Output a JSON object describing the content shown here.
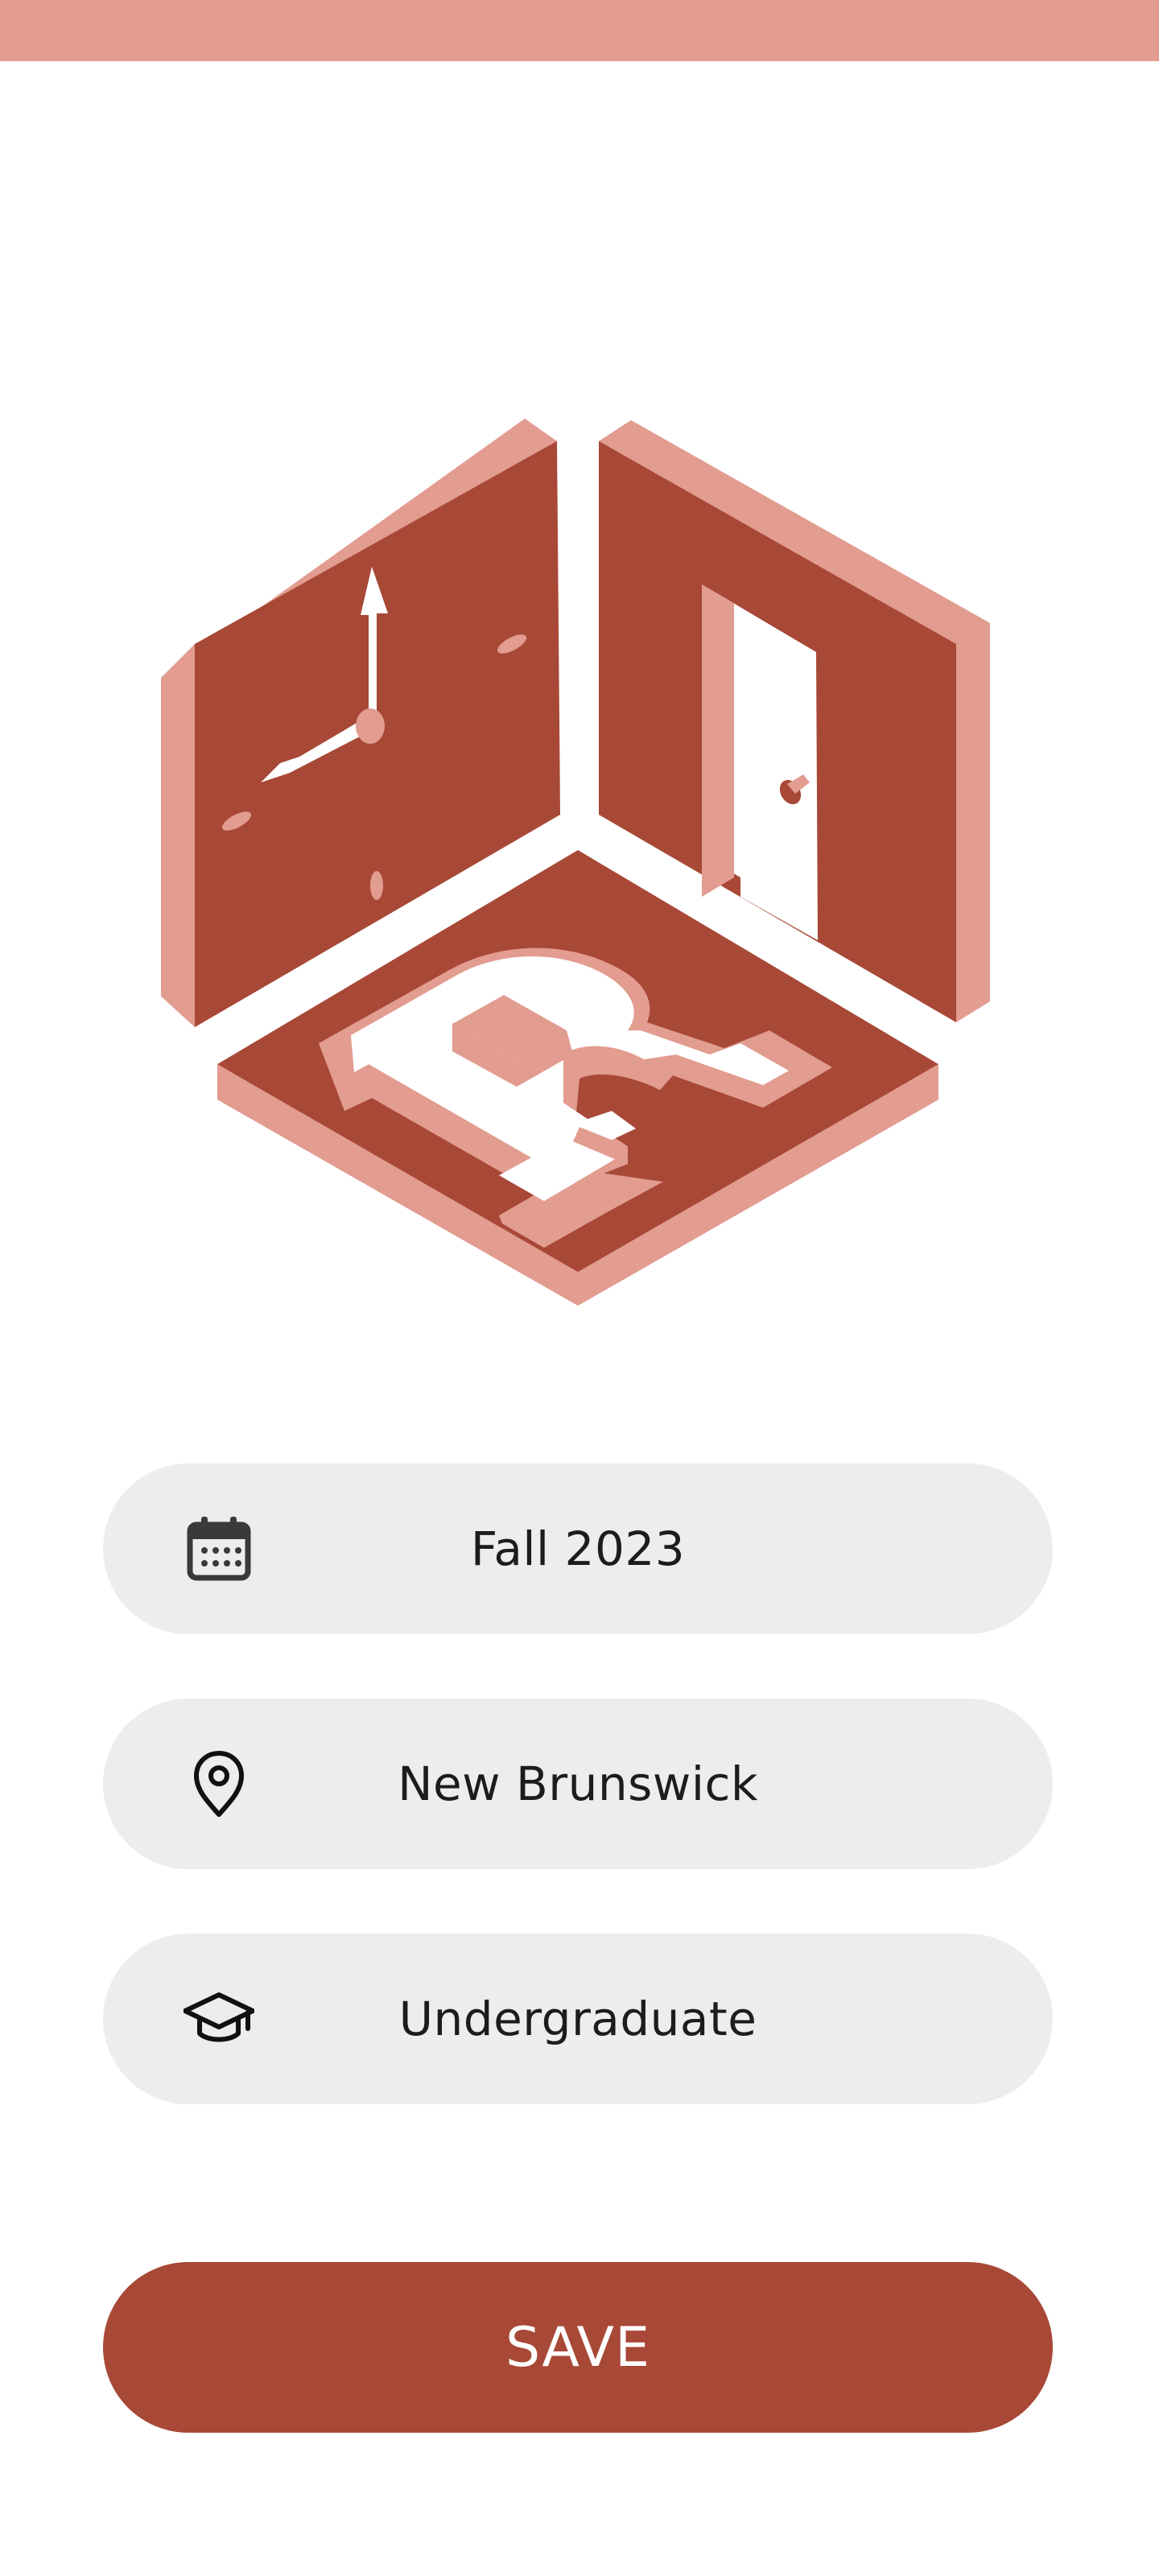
{
  "status_bar": {
    "color": "#e29c90"
  },
  "logo": {
    "name": "clock-door-wrench-hexagon-logo",
    "colors": {
      "primary": "#a84836",
      "accent": "#e29c90"
    }
  },
  "fields": {
    "semester": {
      "icon": "calendar-icon",
      "value": "Fall 2023"
    },
    "campus": {
      "icon": "location-pin-icon",
      "value": "New Brunswick"
    },
    "level": {
      "icon": "graduation-cap-icon",
      "value": "Undergraduate"
    }
  },
  "save": {
    "label": "SAVE",
    "color": "#a84836"
  }
}
